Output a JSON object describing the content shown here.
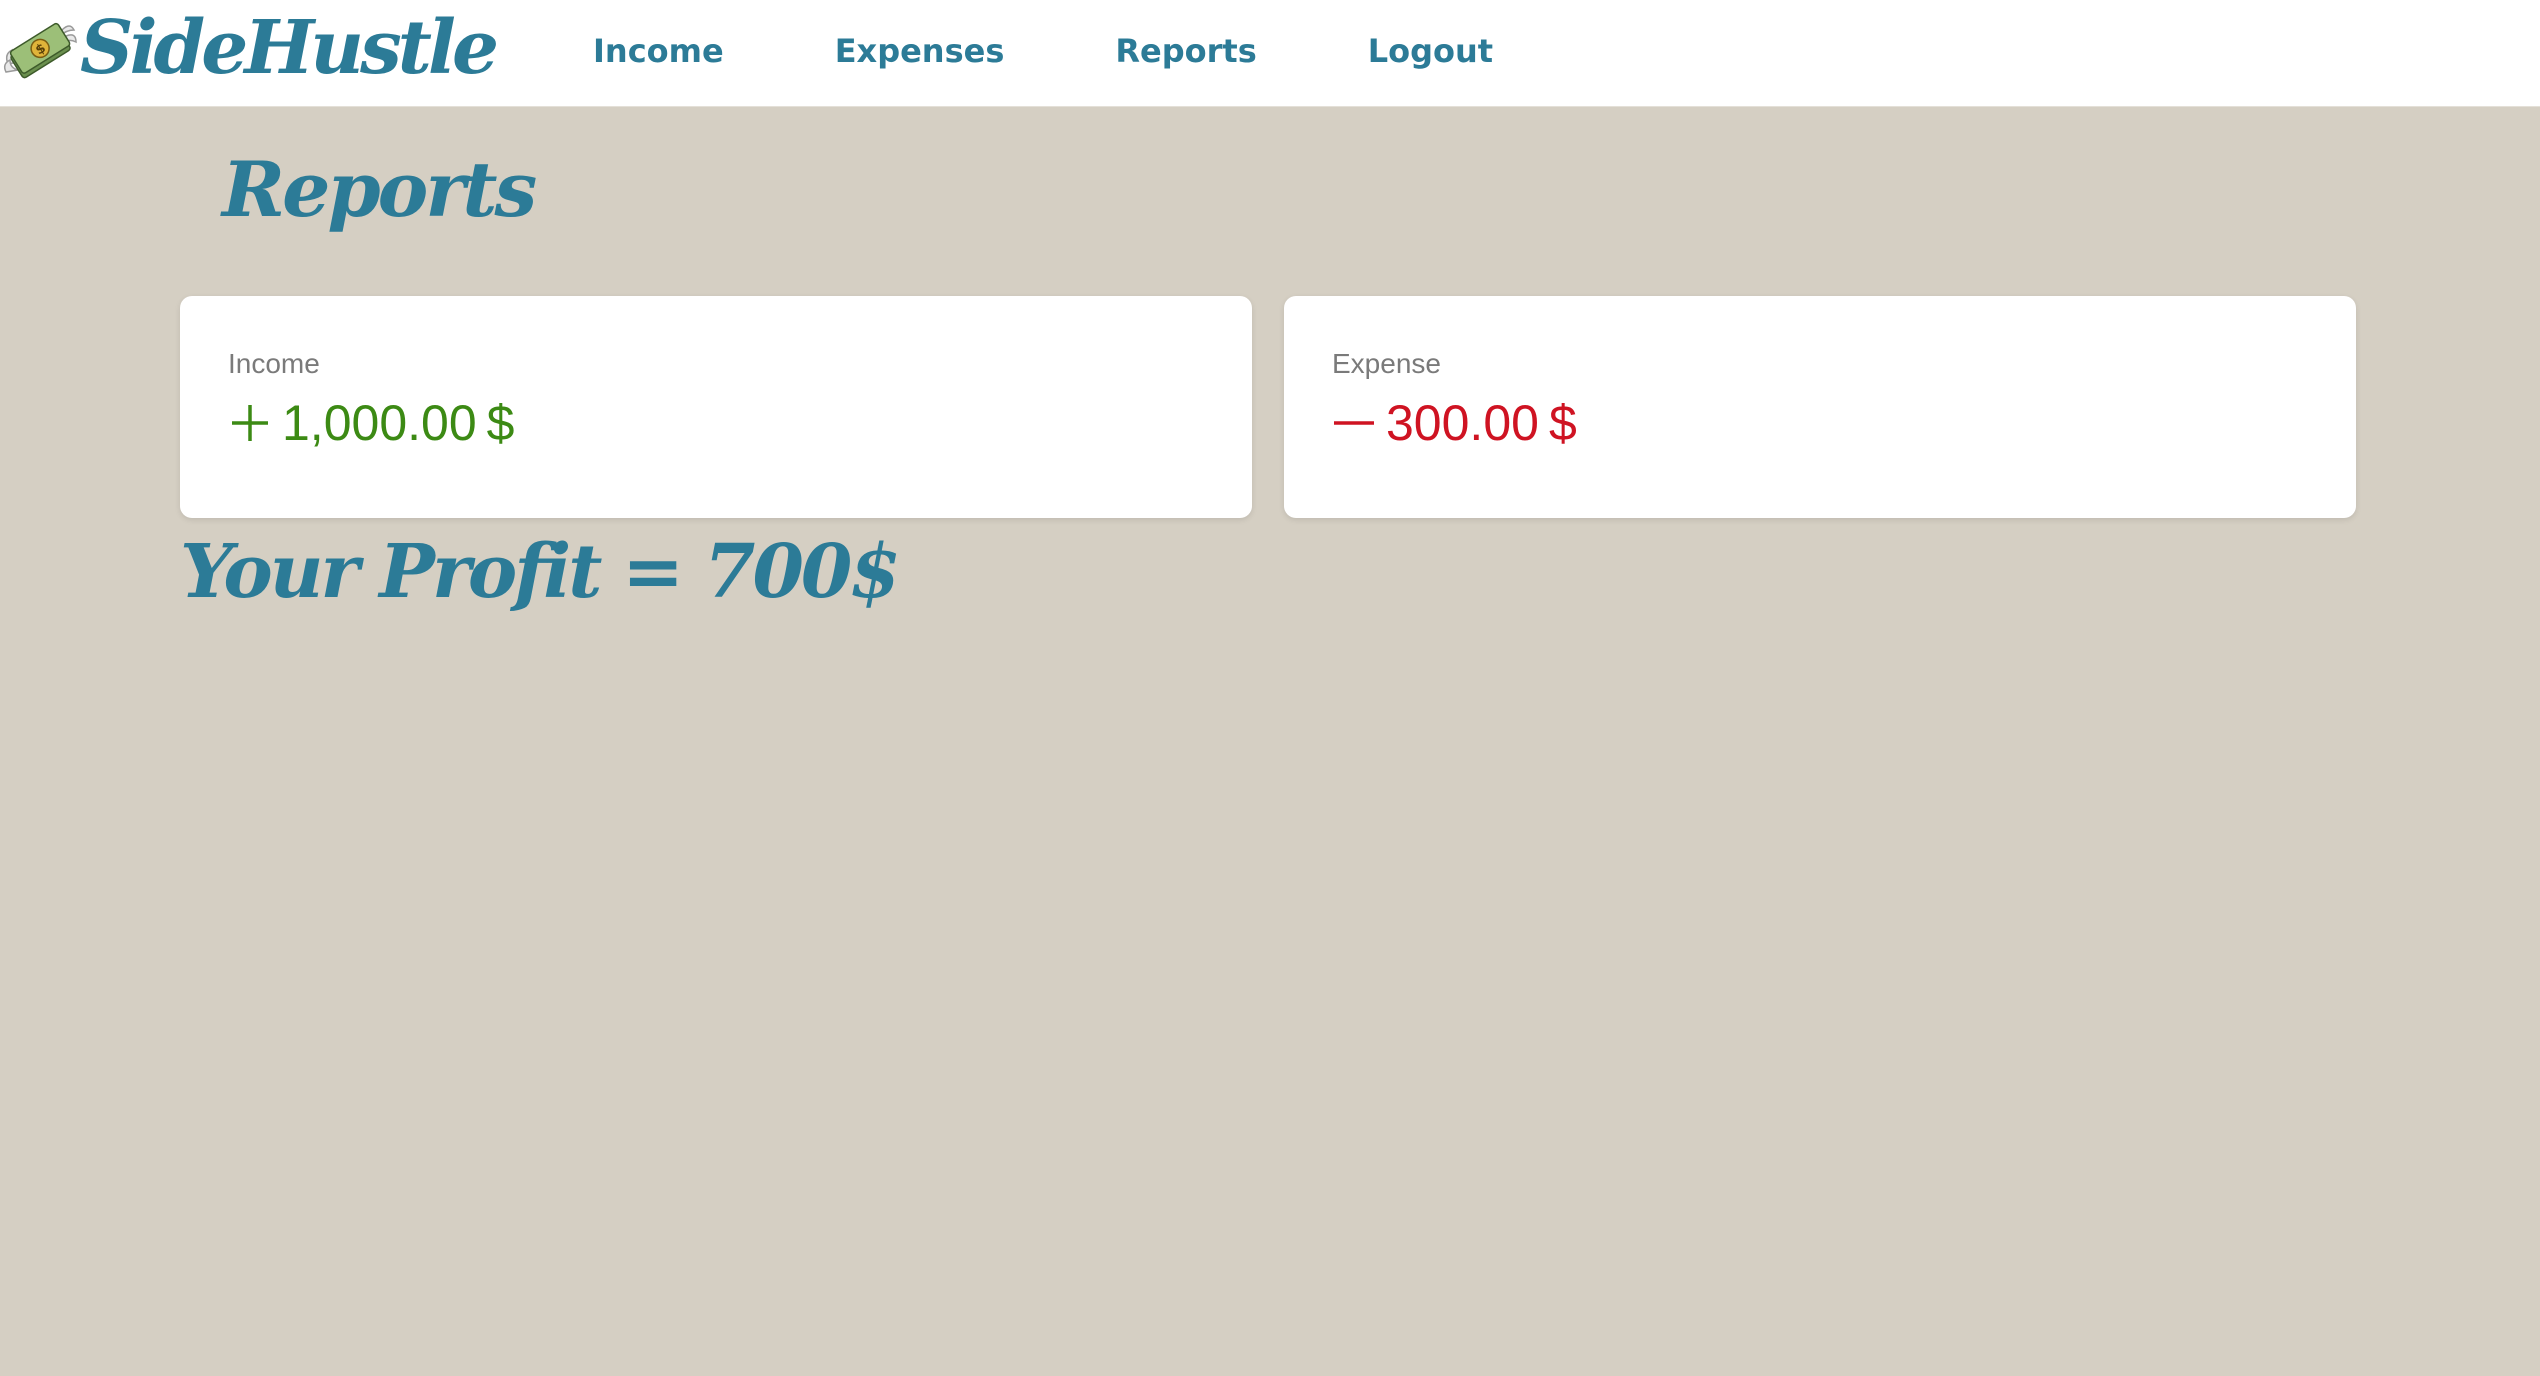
{
  "brand": {
    "name": "SideHustle",
    "logo_icon": "money-with-wings-icon"
  },
  "nav": {
    "items": [
      {
        "label": "Income"
      },
      {
        "label": "Expenses"
      },
      {
        "label": "Reports"
      },
      {
        "label": "Logout"
      }
    ]
  },
  "page": {
    "title": "Reports"
  },
  "cards": {
    "income": {
      "label": "Income",
      "sign_icon": "plus-icon",
      "value": "1,000.00",
      "unit": "$",
      "color": "#3c8a14"
    },
    "expense": {
      "label": "Expense",
      "sign_icon": "minus-icon",
      "value": "300.00",
      "unit": "$",
      "color": "#cf1322"
    }
  },
  "profit": {
    "text": "Your Profit = 700$"
  },
  "colors": {
    "accent": "#2c7b97",
    "background": "#d5cfc3",
    "card": "#ffffff"
  }
}
